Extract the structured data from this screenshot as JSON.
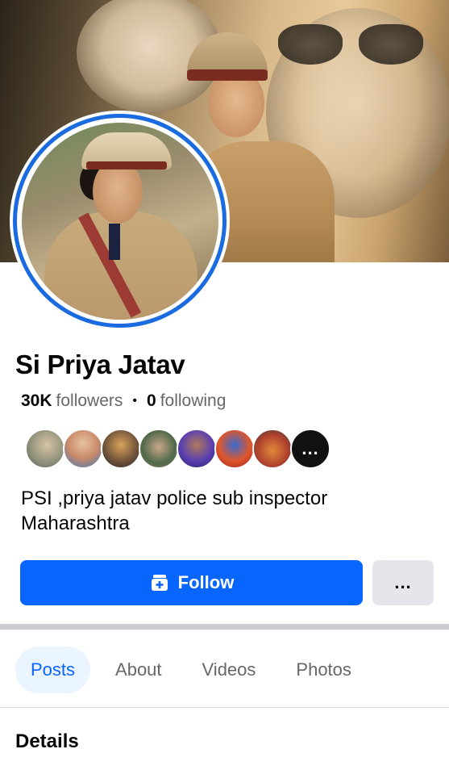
{
  "profile": {
    "name": "Si Priya Jatav",
    "followers_count": "30K",
    "followers_label": "followers",
    "separator": "•",
    "following_count": "0",
    "following_label": "following",
    "bio_line1": "PSI ,priya jatav police sub inspector",
    "bio_line2": "Maharashtra"
  },
  "follower_avatars": [
    {
      "color": "#8d8f7a"
    },
    {
      "color": "#c98a6a"
    },
    {
      "color": "#6b4f3a"
    },
    {
      "color": "#4f6a4a"
    },
    {
      "color": "#5a3fb0"
    },
    {
      "color": "#e0572a"
    },
    {
      "color": "#b2432e"
    },
    {
      "color": "#111111",
      "more_label": "..."
    }
  ],
  "actions": {
    "follow_label": "Follow",
    "more_label": "..."
  },
  "tabs": [
    {
      "label": "Posts",
      "active": true
    },
    {
      "label": "About",
      "active": false
    },
    {
      "label": "Videos",
      "active": false
    },
    {
      "label": "Photos",
      "active": false
    }
  ],
  "section": {
    "details_title": "Details"
  },
  "colors": {
    "accent": "#0866ff",
    "avatar_ring": "#1b6be0",
    "tab_active_bg": "#ebf5ff",
    "secondary_button": "#e4e6eb"
  }
}
